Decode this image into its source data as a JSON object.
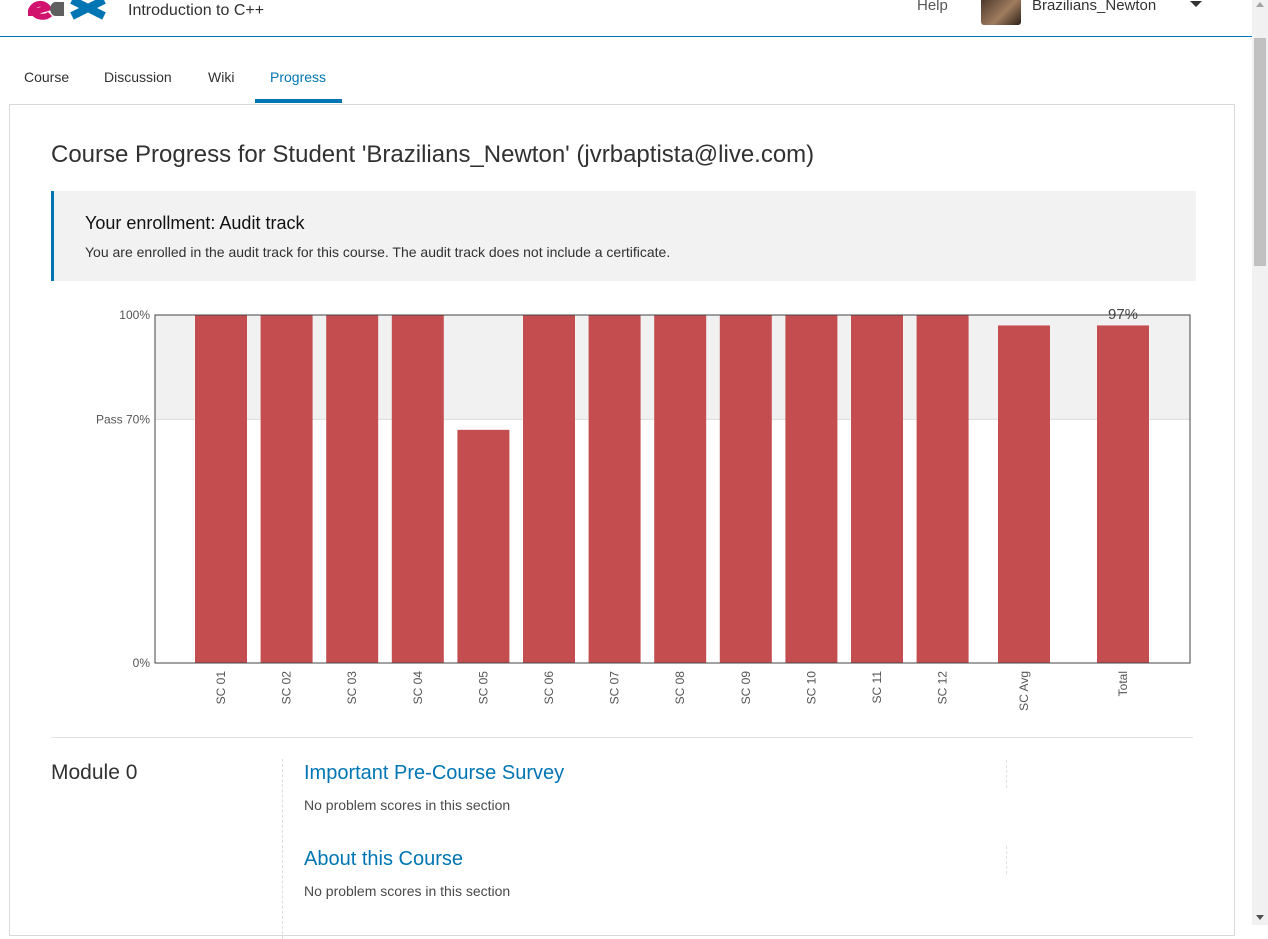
{
  "header": {
    "course_title": "Introduction to C++",
    "help_label": "Help",
    "username": "Brazilians_Newton",
    "logo_icon": "edx-logo-icon",
    "avatar_icon": "user-avatar-icon",
    "caret_icon": "caret-down-icon"
  },
  "tabs": [
    {
      "label": "Course"
    },
    {
      "label": "Discussion"
    },
    {
      "label": "Wiki"
    },
    {
      "label": "Progress",
      "active": true
    }
  ],
  "main": {
    "page_title": "Course Progress for Student 'Brazilians_Newton' (jvrbaptista@live.com)",
    "enrollment": {
      "title": "Your enrollment: Audit track",
      "message": "You are enrolled in the audit track for this course. The audit track does not include a certificate."
    }
  },
  "chart_data": {
    "type": "bar",
    "categories": [
      "SC 01",
      "SC 02",
      "SC 03",
      "SC 04",
      "SC 05",
      "SC 06",
      "SC 07",
      "SC 08",
      "SC 09",
      "SC 10",
      "SC 11",
      "SC 12",
      "SC Avg",
      "Total"
    ],
    "values": [
      100,
      100,
      100,
      100,
      67,
      100,
      100,
      100,
      100,
      100,
      100,
      100,
      97,
      97
    ],
    "ylim": [
      0,
      100
    ],
    "ytick_labels": [
      "0%",
      "Pass 70%",
      "100%"
    ],
    "ytick_values": [
      0,
      70,
      100
    ],
    "annotations": [
      {
        "category": "Total",
        "text": "97%"
      }
    ],
    "pass_threshold": 70,
    "colors": {
      "bar": "#c44d4f",
      "pass_band": "#f1f1f1",
      "axis": "#555555"
    }
  },
  "chapters": [
    {
      "name": "Module 0",
      "sections": [
        {
          "title": "Important Pre-Course Survey",
          "note": "No problem scores in this section"
        },
        {
          "title": "About this Course",
          "note": "No problem scores in this section"
        }
      ]
    }
  ],
  "colors": {
    "accent": "#0075b4"
  }
}
